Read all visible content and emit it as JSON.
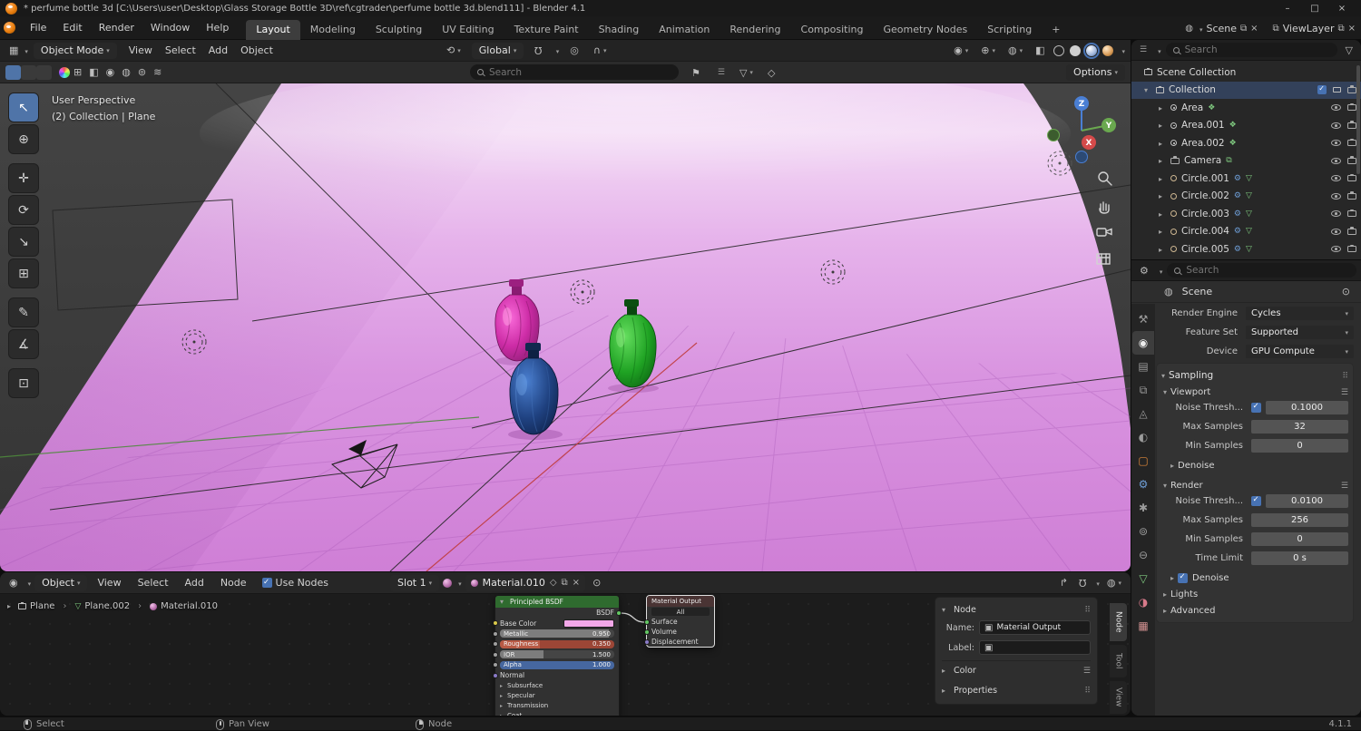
{
  "titlebar": {
    "title": "* perfume bottle 3d [C:\\Users\\user\\Desktop\\Glass Storage Bottle 3D\\ref\\cgtrader\\perfume bottle 3d.blend111] - Blender 4.1"
  },
  "menubar": {
    "menus": [
      "File",
      "Edit",
      "Render",
      "Window",
      "Help"
    ],
    "workspaces": [
      "Layout",
      "Modeling",
      "Sculpting",
      "UV Editing",
      "Texture Paint",
      "Shading",
      "Animation",
      "Rendering",
      "Compositing",
      "Geometry Nodes",
      "Scripting"
    ],
    "scene_label": "Scene",
    "viewlayer_label": "ViewLayer"
  },
  "vp_header": {
    "mode": "Object Mode",
    "menus": [
      "View",
      "Select",
      "Add",
      "Object"
    ],
    "orientation": "Global",
    "options": "Options",
    "search_placeholder": "Search"
  },
  "viewport": {
    "line1": "User Perspective",
    "line2": "(2) Collection | Plane",
    "axis_x": "X",
    "axis_y": "Y",
    "axis_z": "Z"
  },
  "outliner": {
    "search_placeholder": "Search",
    "scene_collection": "Scene Collection",
    "collection": "Collection",
    "items": [
      "Area",
      "Area.001",
      "Area.002",
      "Camera",
      "Circle.001",
      "Circle.002",
      "Circle.003",
      "Circle.004",
      "Circle.005"
    ]
  },
  "properties": {
    "search_placeholder": "Search",
    "context": "Scene",
    "engine_label": "Render Engine",
    "engine": "Cycles",
    "feature_label": "Feature Set",
    "feature": "Supported",
    "device_label": "Device",
    "device": "GPU Compute",
    "sampling": "Sampling",
    "vp": {
      "title": "Viewport",
      "noise_label": "Noise Thresh...",
      "noise": "0.1000",
      "max_label": "Max Samples",
      "max": "32",
      "min_label": "Min Samples",
      "min": "0",
      "denoise": "Denoise"
    },
    "rd": {
      "title": "Render",
      "noise_label": "Noise Thresh...",
      "noise": "0.0100",
      "max_label": "Max Samples",
      "max": "256",
      "min_label": "Min Samples",
      "min": "0",
      "time_label": "Time Limit",
      "time": "0 s",
      "denoise": "Denoise"
    },
    "lights": "Lights",
    "advanced": "Advanced"
  },
  "shader": {
    "mode": "Object",
    "menus": [
      "View",
      "Select",
      "Add",
      "Node"
    ],
    "use_nodes": "Use Nodes",
    "slot": "Slot 1",
    "material": "Material.010",
    "crumbs": [
      "Plane",
      "Plane.002",
      "Material.010"
    ],
    "bsdf": {
      "title": "Principled BSDF",
      "out": "BSDF",
      "base_color": "Base Color",
      "metallic_label": "Metallic",
      "metallic": "0.950",
      "roughness_label": "Roughness",
      "roughness": "0.350",
      "ior_label": "IOR",
      "ior": "1.500",
      "alpha_label": "Alpha",
      "alpha": "1.000",
      "normal": "Normal",
      "collapsed": [
        "Subsurface",
        "Specular",
        "Transmission",
        "Coat"
      ]
    },
    "out": {
      "title": "Material Output",
      "target": "All",
      "inputs": [
        "Surface",
        "Volume",
        "Displacement"
      ]
    },
    "panel": {
      "title": "Node",
      "name_label": "Name:",
      "name": "Material Output",
      "label_label": "Label:",
      "color": "Color",
      "properties": "Properties"
    },
    "tabs": [
      "Node",
      "Tool",
      "View"
    ]
  },
  "statusbar": {
    "select": "Select",
    "pan": "Pan View",
    "node": "Node",
    "version": "4.1.1"
  },
  "icons": {
    "plus": "+",
    "select_tool": "↖",
    "cursor_tool": "⊕",
    "move_tool": "✛",
    "rotate_tool": "⟳",
    "scale_tool": "↘",
    "transform_tool": "⊞",
    "annotate_tool": "✎",
    "measure_tool": "∡",
    "add_cube_tool": "⊡",
    "pivot": "⟲",
    "globe": "◍",
    "magnet": "Ω",
    "prop_edit": "◎",
    "falloff": "∩",
    "editor_viewport": "▦",
    "editor_outliner": "☰",
    "editor_properties": "⚙",
    "editor_shader": "◉",
    "visibility": "◉",
    "gizmo": "⊕",
    "overlays": "◍",
    "xray": "◧",
    "bookmark": "⚑",
    "funnel": "▽",
    "shield": "◇",
    "scene": "◍",
    "viewlayer": "⧉",
    "pin": "⊙",
    "close": "×",
    "copy": "⧉",
    "cube": "▣",
    "nodetree": "❖",
    "wrench": "⚙",
    "data": "▽",
    "snap_arrow": "↱",
    "sel_modes": [
      "⊞",
      "◧",
      "◉",
      "◍",
      "⊚",
      "≋"
    ],
    "props_tabs": [
      "⚒",
      "◉",
      "▤",
      "⧉",
      "◬",
      "◐",
      "▢",
      "⚙",
      "✱",
      "⊚",
      "⊖",
      "▽",
      "◑",
      "▦"
    ]
  },
  "colors": {
    "accent": "#4772b3",
    "plane_pink": "#dd9fe3",
    "bottle_pink": "#cc2fa8",
    "bottle_blue": "#1c3d77",
    "bottle_green": "#1e9e22"
  }
}
